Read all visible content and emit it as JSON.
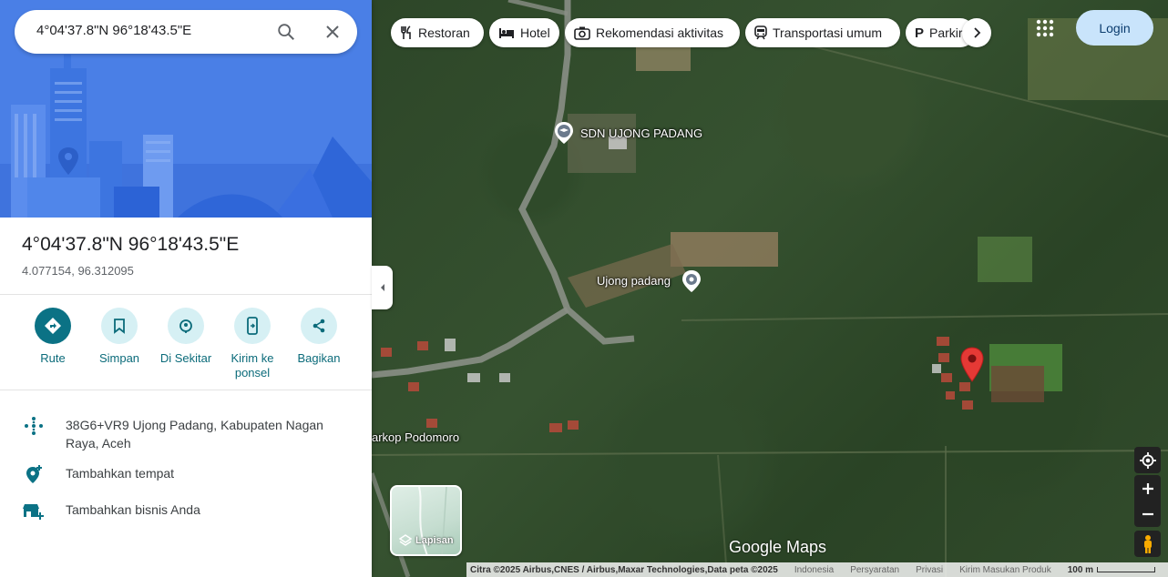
{
  "search": {
    "value": "4°04'37.8\"N 96°18'43.5\"E"
  },
  "place": {
    "title": "4°04'37.8\"N 96°18'43.5\"E",
    "coords": "4.077154, 96.312095"
  },
  "actions": [
    {
      "label": "Rute"
    },
    {
      "label": "Simpan"
    },
    {
      "label": "Di Sekitar"
    },
    {
      "label": "Kirim ke ponsel"
    },
    {
      "label": "Bagikan"
    }
  ],
  "info": {
    "plus_code": "38G6+VR9 Ujong Padang, Kabupaten Nagan Raya, Aceh",
    "add_place": "Tambahkan tempat",
    "add_business": "Tambahkan bisnis Anda"
  },
  "chips": [
    {
      "label": "Restoran",
      "icon": "fork-knife-icon"
    },
    {
      "label": "Hotel",
      "icon": "bed-icon"
    },
    {
      "label": "Rekomendasi aktivitas",
      "icon": "camera-icon"
    },
    {
      "label": "Transportasi umum",
      "icon": "train-icon"
    },
    {
      "label": "Parkir",
      "icon": "parking-icon"
    }
  ],
  "header": {
    "login": "Login"
  },
  "map": {
    "labels": {
      "school": "SDN UJONG PADANG",
      "village": "Ujong padang",
      "cafe": "arkop Podomoro"
    },
    "layers_label": "Lapisan",
    "logo": "Google Maps"
  },
  "footer": {
    "attribution": "Citra ©2025 Airbus,CNES / Airbus,Maxar Technologies,Data peta ©2025",
    "country": "Indonesia",
    "terms": "Persyaratan",
    "privacy": "Privasi",
    "feedback": "Kirim Masukan Produk",
    "scale": "100 m"
  },
  "colors": {
    "accent": "#0b7285",
    "pin": "#e53935",
    "login_bg": "#c9e4fb"
  }
}
